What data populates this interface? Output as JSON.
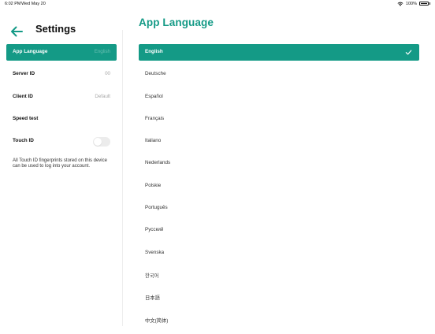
{
  "status_bar": {
    "time": "6:02 PM",
    "date": "Wed May 20",
    "battery": "100%"
  },
  "settings": {
    "title": "Settings",
    "items": [
      {
        "label": "App Language",
        "value": "English",
        "active": true
      },
      {
        "label": "Server ID",
        "value": "00"
      },
      {
        "label": "Client ID",
        "value": "Default"
      },
      {
        "label": "Speed test",
        "value": ""
      },
      {
        "label": "Touch ID",
        "toggle": false
      }
    ],
    "touch_id_note": "All Touch ID fingerprints stored on this device can be used to log into your account."
  },
  "language": {
    "title": "App Language",
    "selected": "English",
    "options": [
      "English",
      "Deutsche",
      "Español",
      "Français",
      "Italiano",
      "Nederlands",
      "Polskie",
      "Português",
      "Русский",
      "Svenska",
      "한국어",
      "日本語",
      "中文(简体)"
    ]
  },
  "colors": {
    "accent": "#149a86",
    "muted": "#a8a8a8",
    "divider": "#ededed"
  },
  "icons": {
    "back": "arrow-left-icon",
    "check": "checkmark-icon",
    "wifi": "wifi-icon",
    "battery": "battery-icon"
  }
}
